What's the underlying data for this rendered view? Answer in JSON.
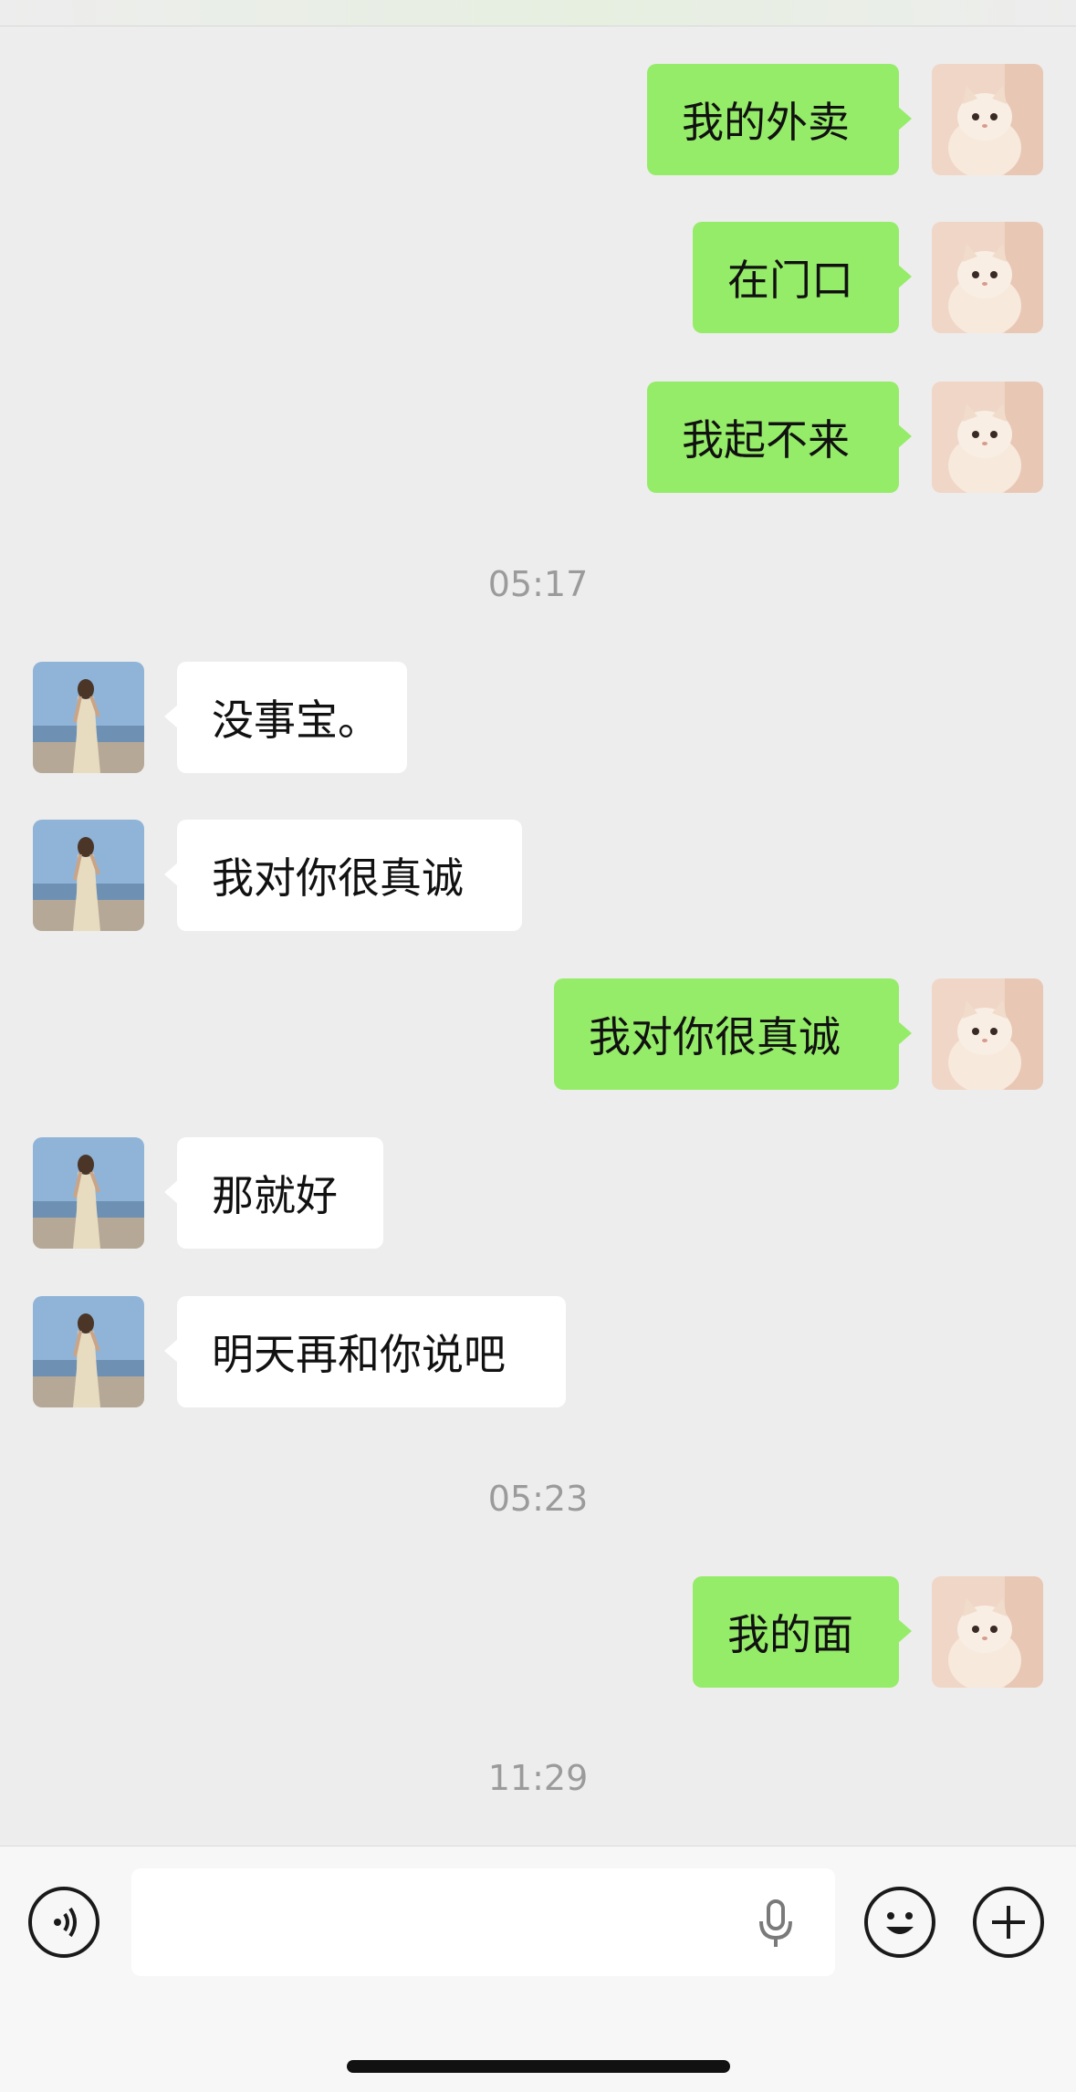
{
  "messages": [
    {
      "side": "mine",
      "text": "我的外卖"
    },
    {
      "side": "mine",
      "text": "在门口"
    },
    {
      "side": "mine",
      "text": "我起不来"
    },
    {
      "type": "time",
      "text": "05:17"
    },
    {
      "side": "theirs",
      "text": "没事宝。"
    },
    {
      "side": "theirs",
      "text": "我对你很真诚"
    },
    {
      "side": "mine",
      "text": "我对你很真诚"
    },
    {
      "side": "theirs",
      "text": "那就好"
    },
    {
      "side": "theirs",
      "text": "明天再和你说吧"
    },
    {
      "type": "time",
      "text": "05:23"
    },
    {
      "side": "mine",
      "text": "我的面"
    },
    {
      "type": "time",
      "text": "11:29"
    }
  ],
  "colors": {
    "background": "#ededed",
    "my_bubble": "#95ec69",
    "their_bubble": "#ffffff",
    "timestamp": "#9b9b9b"
  },
  "avatars": {
    "mine": "cat-avatar",
    "theirs": "woman-beach-avatar"
  },
  "input_bar": {
    "voice_icon": "voice-mode-icon",
    "mic_icon": "microphone-icon",
    "emoji_icon": "emoji-icon",
    "plus_icon": "plus-icon",
    "text_value": ""
  }
}
